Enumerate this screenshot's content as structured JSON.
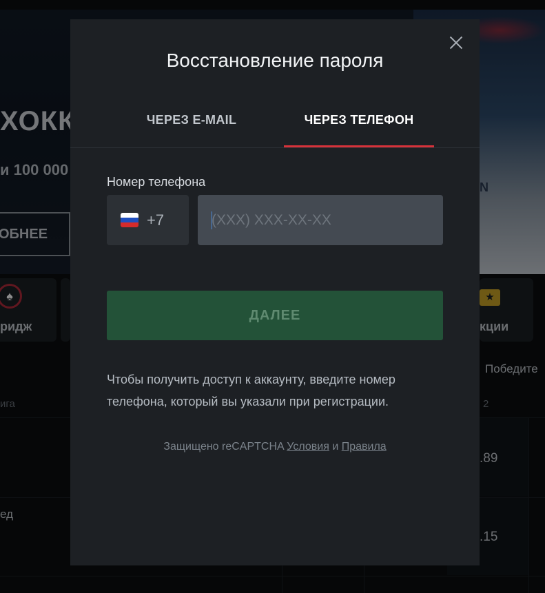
{
  "background": {
    "banner_title": "ХОКК",
    "banner_subtitle": "100 000",
    "banner_prefix": "и",
    "banner_button": "ОБНЕЕ",
    "rink_text": "N",
    "category_left": "ридж",
    "category_right": "кции",
    "column_header": "Победите",
    "sub_header_left": "ига",
    "sub_header_right": "2",
    "row1_odd": ".89",
    "row2_team": "ед",
    "row2_odd": ".15"
  },
  "modal": {
    "title": "Восстановление пароля",
    "tabs": [
      {
        "label": "ЧЕРЕЗ E-MAIL",
        "active": false
      },
      {
        "label": "ЧЕРЕЗ ТЕЛЕФОН",
        "active": true
      }
    ],
    "phone_label": "Номер телефона",
    "country_code": "+7",
    "phone_value": "",
    "phone_placeholder": "(XXX) XXX-XX-XX",
    "next_button": "ДАЛЕЕ",
    "hint": "Чтобы получить доступ к аккаунту, введите номер телефона, который вы указали при регистрации.",
    "recaptcha": {
      "prefix": "Защищено reCAPTCHA",
      "terms": "Условия",
      "and": "и",
      "rules": "Правила"
    }
  },
  "icons": {
    "close": "close-icon",
    "flag": "russia-flag-icon",
    "spade": "spade-icon",
    "ticket": "ticket-star-icon"
  },
  "colors": {
    "accent": "#d7323a",
    "next_button_bg": "#235238",
    "modal_bg": "#1d2024"
  }
}
